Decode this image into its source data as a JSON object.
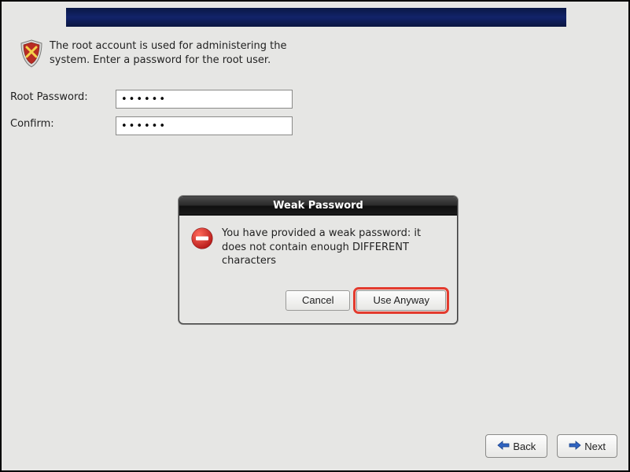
{
  "intro_text": "The root account is used for administering the system.  Enter a password for the root user.",
  "labels": {
    "root_password": "Root Password:",
    "confirm": "Confirm:"
  },
  "inputs": {
    "root_password_value": "••••••",
    "confirm_value": "••••••"
  },
  "dialog": {
    "title": "Weak Password",
    "message": "You have provided a weak password: it does not contain enough DIFFERENT characters",
    "cancel": "Cancel",
    "use_anyway": "Use Anyway"
  },
  "nav": {
    "back": "Back",
    "next": "Next"
  }
}
